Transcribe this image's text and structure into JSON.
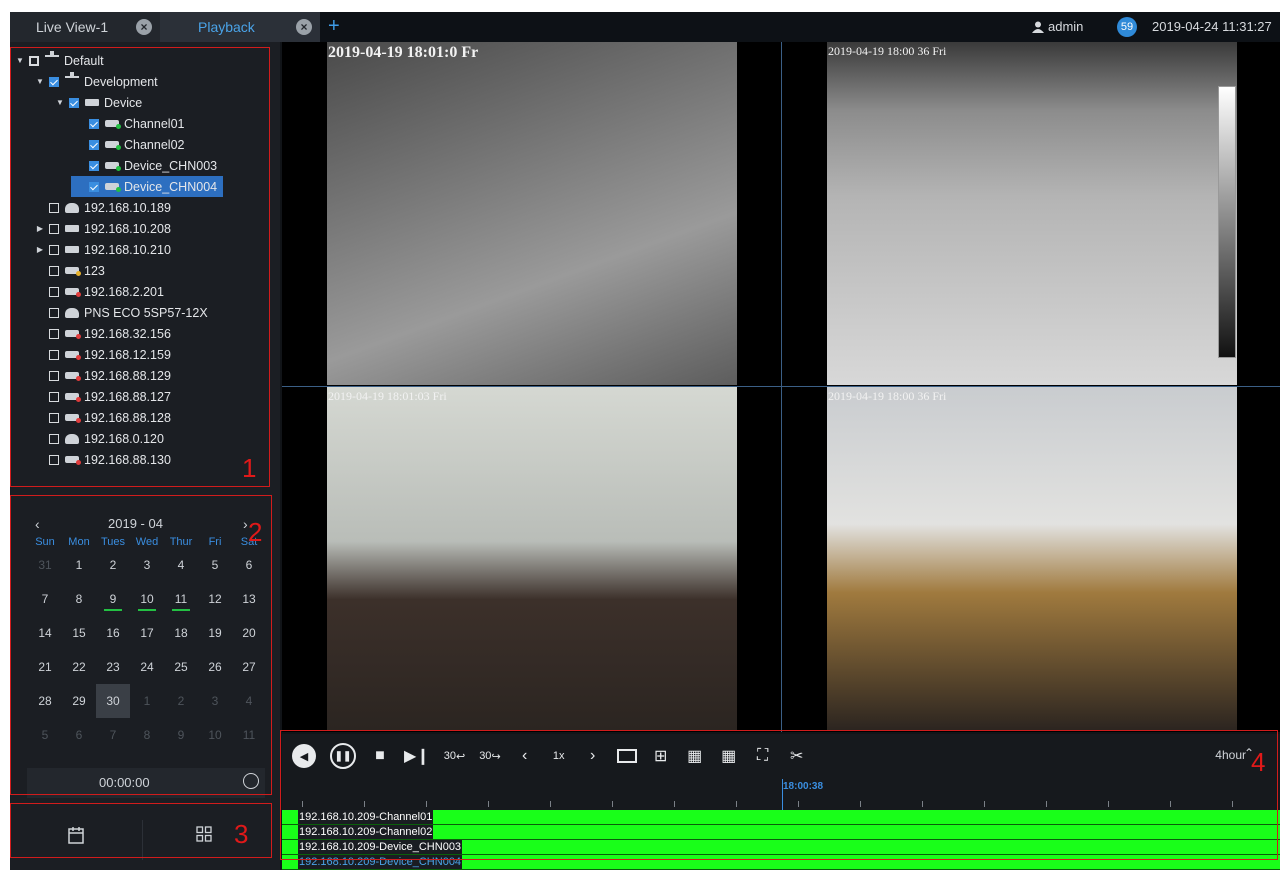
{
  "tabs": [
    {
      "label": "Live View-1"
    },
    {
      "label": "Playback",
      "active": true
    }
  ],
  "header": {
    "user": "admin",
    "notifications": "59",
    "datetime": "2019-04-24 11:31:27"
  },
  "tree": [
    {
      "label": "Default",
      "level": 0,
      "arrow": "down",
      "checked": "none",
      "icon": "org"
    },
    {
      "label": "Development",
      "level": 1,
      "arrow": "down",
      "checked": "on",
      "icon": "org"
    },
    {
      "label": "Device",
      "level": 2,
      "arrow": "down",
      "checked": "on",
      "icon": "dev"
    },
    {
      "label": "Channel01",
      "level": 3,
      "checked": "on",
      "icon": "cam"
    },
    {
      "label": "Channel02",
      "level": 3,
      "checked": "on",
      "icon": "cam"
    },
    {
      "label": "Device_CHN003",
      "level": 3,
      "checked": "on",
      "icon": "cam"
    },
    {
      "label": "Device_CHN004",
      "level": 3,
      "checked": "on",
      "icon": "cam",
      "selected": true
    },
    {
      "label": "192.168.10.189",
      "level": 1,
      "checked": "off",
      "icon": "dome"
    },
    {
      "label": "192.168.10.208",
      "level": 1,
      "arrow": "right",
      "checked": "off",
      "icon": "nvr"
    },
    {
      "label": "192.168.10.210",
      "level": 1,
      "arrow": "right",
      "checked": "off",
      "icon": "nvr"
    },
    {
      "label": "123",
      "level": 1,
      "checked": "off",
      "icon": "camy"
    },
    {
      "label": "192.168.2.201",
      "level": 1,
      "checked": "off",
      "icon": "camoff"
    },
    {
      "label": "PNS ECO 5SP57-12X",
      "level": 1,
      "checked": "off",
      "icon": "dome"
    },
    {
      "label": "192.168.32.156",
      "level": 1,
      "checked": "off",
      "icon": "camoff"
    },
    {
      "label": "192.168.12.159",
      "level": 1,
      "checked": "off",
      "icon": "camoff"
    },
    {
      "label": "192.168.88.129",
      "level": 1,
      "checked": "off",
      "icon": "camoff"
    },
    {
      "label": "192.168.88.127",
      "level": 1,
      "checked": "off",
      "icon": "camoff"
    },
    {
      "label": "192.168.88.128",
      "level": 1,
      "checked": "off",
      "icon": "camoff"
    },
    {
      "label": "192.168.0.120",
      "level": 1,
      "checked": "off",
      "icon": "dome"
    },
    {
      "label": "192.168.88.130",
      "level": 1,
      "checked": "off",
      "icon": "camoff"
    }
  ],
  "calendar": {
    "prev": "‹",
    "next": "›",
    "month_label": "2019 - 04",
    "weekdays": [
      "Sun",
      "Mon",
      "Tues",
      "Wed",
      "Thur",
      "Fri",
      "Sat"
    ],
    "weeks": [
      [
        {
          "d": "31",
          "dim": true
        },
        {
          "d": "1"
        },
        {
          "d": "2"
        },
        {
          "d": "3"
        },
        {
          "d": "4"
        },
        {
          "d": "5"
        },
        {
          "d": "6"
        }
      ],
      [
        {
          "d": "7"
        },
        {
          "d": "8"
        },
        {
          "d": "9",
          "rec": true
        },
        {
          "d": "10",
          "rec": true
        },
        {
          "d": "11",
          "rec": true
        },
        {
          "d": "12"
        },
        {
          "d": "13"
        }
      ],
      [
        {
          "d": "14"
        },
        {
          "d": "15"
        },
        {
          "d": "16"
        },
        {
          "d": "17"
        },
        {
          "d": "18"
        },
        {
          "d": "19"
        },
        {
          "d": "20"
        }
      ],
      [
        {
          "d": "21"
        },
        {
          "d": "22"
        },
        {
          "d": "23"
        },
        {
          "d": "24"
        },
        {
          "d": "25"
        },
        {
          "d": "26"
        },
        {
          "d": "27"
        }
      ],
      [
        {
          "d": "28"
        },
        {
          "d": "29"
        },
        {
          "d": "30",
          "today": true
        },
        {
          "d": "1",
          "dim": true
        },
        {
          "d": "2",
          "dim": true
        },
        {
          "d": "3",
          "dim": true
        },
        {
          "d": "4",
          "dim": true
        }
      ],
      [
        {
          "d": "5",
          "dim": true
        },
        {
          "d": "6",
          "dim": true
        },
        {
          "d": "7",
          "dim": true
        },
        {
          "d": "8",
          "dim": true
        },
        {
          "d": "9",
          "dim": true
        },
        {
          "d": "10",
          "dim": true
        },
        {
          "d": "11",
          "dim": true
        }
      ]
    ],
    "time": "00:00:00"
  },
  "annotations": [
    "1",
    "2",
    "3",
    "4"
  ],
  "video": [
    {
      "osd": "2019-04-19 18:01:0  Fr",
      "big": true
    },
    {
      "osd": "2019-04-19 18:00 36 Fri"
    },
    {
      "osd": "2019-04-19 18:01:03 Fri"
    },
    {
      "osd": "2019-04-19 18:00 36 Fri"
    }
  ],
  "toolbar": {
    "back30": "30",
    "fwd30": "30",
    "speed": "1x",
    "scale": "4hour"
  },
  "timeline": {
    "cursor_time": "18:00:38",
    "tracks": [
      {
        "label": "192.168.10.209-Channel01"
      },
      {
        "label": "192.168.10.209-Channel02"
      },
      {
        "label": "192.168.10.209-Device_CHN003"
      },
      {
        "label": "192.168.10.209-Device_CHN004",
        "selected": true
      }
    ]
  },
  "colors": {
    "accent": "#3a8ee0",
    "record": "#19ff19",
    "annotation": "#d11c1c"
  }
}
